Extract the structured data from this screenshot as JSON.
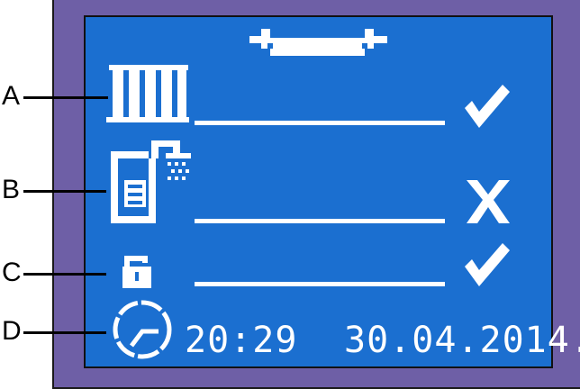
{
  "labels": {
    "a": "A",
    "b": "B",
    "c": "C",
    "d": "D"
  },
  "status": {
    "heating": "check",
    "hot_water": "cross",
    "lock": "check"
  },
  "clock": {
    "time": "20:29",
    "date": "30.04.2014."
  },
  "icons": {
    "header": "wrench-icon",
    "row_a": "radiator-icon",
    "row_b": "boiler-shower-icon",
    "row_c": "padlock-icon",
    "row_d": "clock-icon"
  },
  "colors": {
    "screen": "#1b6fd0",
    "bezel": "#6e5fa6",
    "pixel": "#ffffff"
  }
}
